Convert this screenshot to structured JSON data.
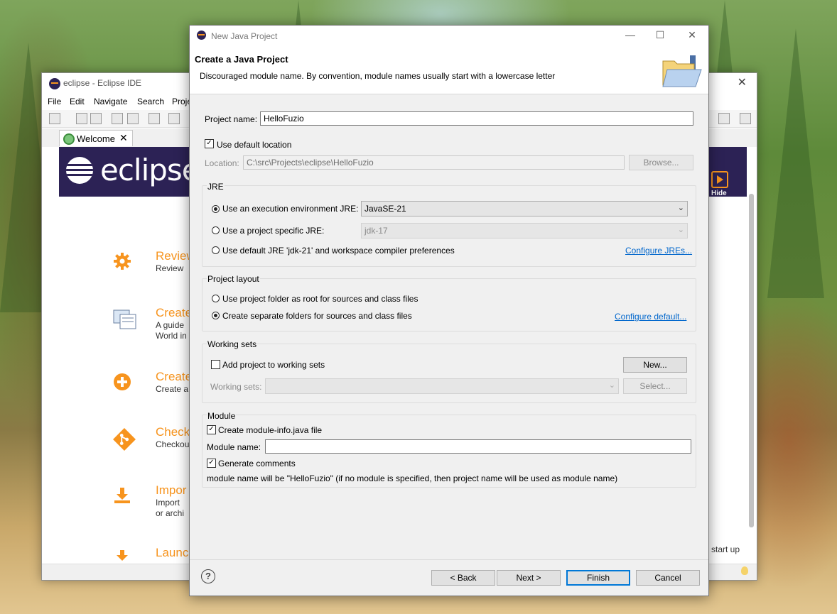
{
  "eclipse_window": {
    "title": "eclipse - Eclipse IDE",
    "menu": [
      "File",
      "Edit",
      "Navigate",
      "Search",
      "Proje"
    ],
    "welcome_tab": "Welcome",
    "logo_text": "eclipse",
    "hide_label": "Hide",
    "welcome_items": [
      {
        "title": "Review",
        "desc": "Review",
        "icon": "gear-icon"
      },
      {
        "title": "Create",
        "desc": "A guide\nWorld in",
        "icon": "create-project-icon"
      },
      {
        "title": "Create",
        "desc": "Create a",
        "icon": "add-icon"
      },
      {
        "title": "Check",
        "desc": "Checkou",
        "icon": "git-icon"
      },
      {
        "title": "Impor",
        "desc": "Import\nor archi",
        "icon": "import-icon"
      },
      {
        "title": "Launc",
        "desc": "",
        "icon": "launch-icon"
      }
    ],
    "startup_text": "start up"
  },
  "dialog": {
    "window_title": "New Java Project",
    "header_title": "Create a Java Project",
    "header_message": "Discouraged module name. By convention, module names usually start with a lowercase letter",
    "project_name_label": "Project name:",
    "project_name_value": "HelloFuzio",
    "use_default_location_label": "Use default location",
    "use_default_location_checked": true,
    "location_label": "Location:",
    "location_value": "C:\\src\\Projects\\eclipse\\HelloFuzio",
    "browse_label": "Browse...",
    "jre": {
      "group_title": "JRE",
      "option_env_label": "Use an execution environment JRE:",
      "env_value": "JavaSE-21",
      "option_specific_label": "Use a project specific JRE:",
      "specific_value": "jdk-17",
      "option_default_label": "Use default JRE 'jdk-21' and workspace compiler preferences",
      "configure_link": "Configure JREs...",
      "selected": "env"
    },
    "layout": {
      "group_title": "Project layout",
      "option_root_label": "Use project folder as root for sources and class files",
      "option_separate_label": "Create separate folders for sources and class files",
      "configure_link": "Configure default...",
      "selected": "separate"
    },
    "working_sets": {
      "group_title": "Working sets",
      "add_label": "Add project to working sets",
      "add_checked": false,
      "new_button": "New...",
      "sets_label": "Working sets:",
      "select_button": "Select..."
    },
    "module": {
      "group_title": "Module",
      "create_label": "Create module-info.java file",
      "create_checked": true,
      "name_label": "Module name:",
      "name_value": "",
      "generate_label": "Generate comments",
      "generate_checked": true,
      "info_text": "module name will be \"HelloFuzio\"  (if no module is specified, then project name will be used as module name)"
    },
    "buttons": {
      "back": "< Back",
      "next": "Next >",
      "finish": "Finish",
      "cancel": "Cancel"
    }
  },
  "colors": {
    "eclipse_banner": "#2c2255",
    "eclipse_orange": "#f7941e",
    "link_blue": "#0066cc",
    "default_button_border": "#0078d7"
  }
}
